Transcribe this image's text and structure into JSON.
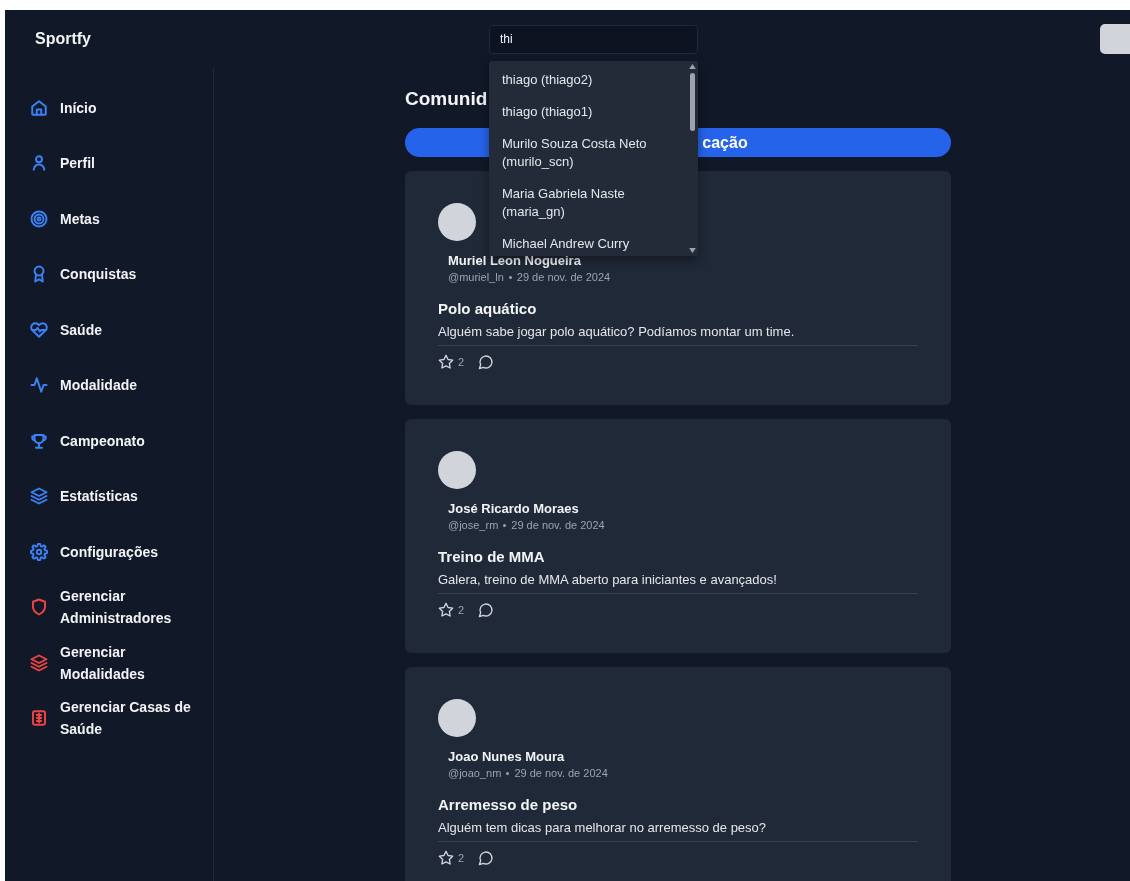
{
  "app": {
    "name": "Sportfy"
  },
  "search": {
    "value": "thi"
  },
  "search_results": [
    {
      "label": "thiago (thiago2)"
    },
    {
      "label": "thiago (thiago1)"
    },
    {
      "label": "Murilo Souza Costa Neto (murilo_scn)"
    },
    {
      "label": "Maria Gabriela Naste (maria_gn)"
    },
    {
      "label": "Michael Andrew Curry"
    }
  ],
  "sidebar": {
    "items": [
      {
        "label": "Início",
        "color": "#3b82f6"
      },
      {
        "label": "Perfil",
        "color": "#3b82f6"
      },
      {
        "label": "Metas",
        "color": "#3b82f6"
      },
      {
        "label": "Conquistas",
        "color": "#3b82f6"
      },
      {
        "label": "Saúde",
        "color": "#3b82f6"
      },
      {
        "label": "Modalidade",
        "color": "#3b82f6"
      },
      {
        "label": "Campeonato",
        "color": "#3b82f6"
      },
      {
        "label": "Estatísticas",
        "color": "#3b82f6"
      },
      {
        "label": "Configurações",
        "color": "#3b82f6"
      },
      {
        "label": "Gerenciar Administradores",
        "color": "#ef4444"
      },
      {
        "label": "Gerenciar Modalidades",
        "color": "#ef4444"
      },
      {
        "label": "Gerenciar Casas de Saúde",
        "color": "#ef4444"
      }
    ]
  },
  "page": {
    "title": "Comunid",
    "new_post_button": "cação"
  },
  "posts": [
    {
      "author": "Muriel Leon Nogueira",
      "handle": "@muriel_ln",
      "date": "29 de nov. de 2024",
      "title": "Polo aquático",
      "body": "Alguém sabe jogar polo aquático? Podíamos montar um time.",
      "likes": "2"
    },
    {
      "author": "José Ricardo Moraes",
      "handle": "@jose_rm",
      "date": "29 de nov. de 2024",
      "title": "Treino de MMA",
      "body": "Galera, treino de MMA aberto para iniciantes e avançados!",
      "likes": "2"
    },
    {
      "author": "Joao Nunes Moura",
      "handle": "@joao_nm",
      "date": "29 de nov. de 2024",
      "title": "Arremesso de peso",
      "body": "Alguém tem dicas para melhorar no arremesso de peso?",
      "likes": "2"
    }
  ]
}
